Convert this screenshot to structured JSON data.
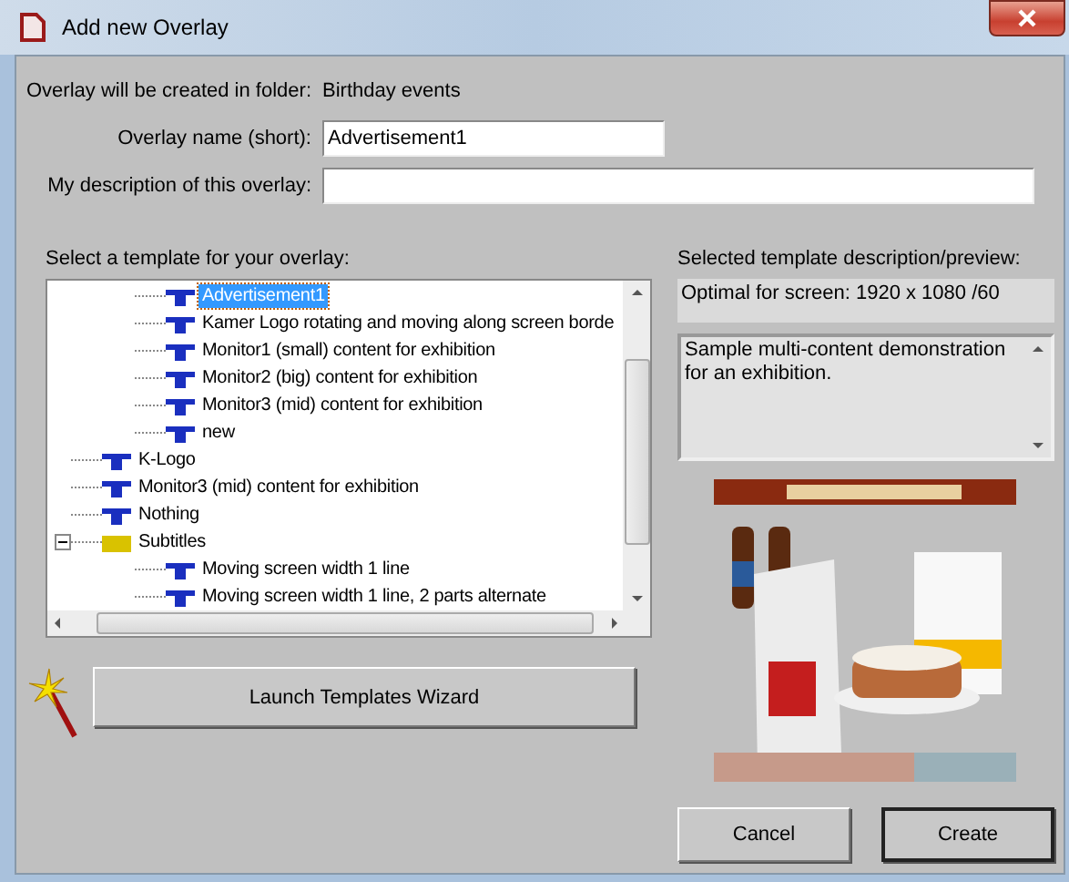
{
  "window": {
    "title": "Add new Overlay"
  },
  "fields": [
    {
      "kind": "static",
      "label": "Overlay will be created in folder:",
      "value": "Birthday events"
    },
    {
      "kind": "input",
      "label": "Overlay name (short):",
      "value": "Advertisement1"
    },
    {
      "kind": "input",
      "label": "My description of this overlay:"
    }
  ],
  "template_list": {
    "label": "Select a template for your overlay:",
    "items": [
      {
        "kind": "hidden_parent",
        "children": [
          {
            "kind": "template",
            "label": "Advertisement1",
            "selected": true
          },
          {
            "kind": "template",
            "label": "Kamer Logo rotating and moving along screen borde",
            "selected": false
          },
          {
            "kind": "template",
            "label": "Monitor1 (small) content for exhibition",
            "selected": false
          },
          {
            "kind": "template",
            "label": "Monitor2 (big) content for exhibition",
            "selected": false
          },
          {
            "kind": "template",
            "label": "Monitor3 (mid) content for exhibition",
            "selected": false
          },
          {
            "kind": "template",
            "label": "new",
            "selected": false
          }
        ]
      },
      {
        "kind": "template",
        "label": "K-Logo",
        "selected": false
      },
      {
        "kind": "template",
        "label": "Monitor3 (mid) content for exhibition",
        "selected": false
      },
      {
        "kind": "template",
        "label": "Nothing",
        "selected": false
      },
      {
        "kind": "folder",
        "label": "Subtitles",
        "selected": false,
        "expanded": true,
        "children": [
          {
            "kind": "template",
            "label": "Moving screen width 1 line",
            "selected": false
          },
          {
            "kind": "template",
            "label": "Moving screen width 1 line, 2 parts alternate",
            "selected": false
          }
        ]
      }
    ]
  },
  "preview": {
    "label": "Selected template description/preview:",
    "screen": "Optimal for screen: 1920 x 1080 /60",
    "description": "Sample multi-content demonstration for an exhibition."
  },
  "wizard_button": "Launch Templates Wizard",
  "buttons": [
    {
      "label": "Cancel",
      "default": false
    },
    {
      "label": "Create",
      "default": true
    }
  ]
}
